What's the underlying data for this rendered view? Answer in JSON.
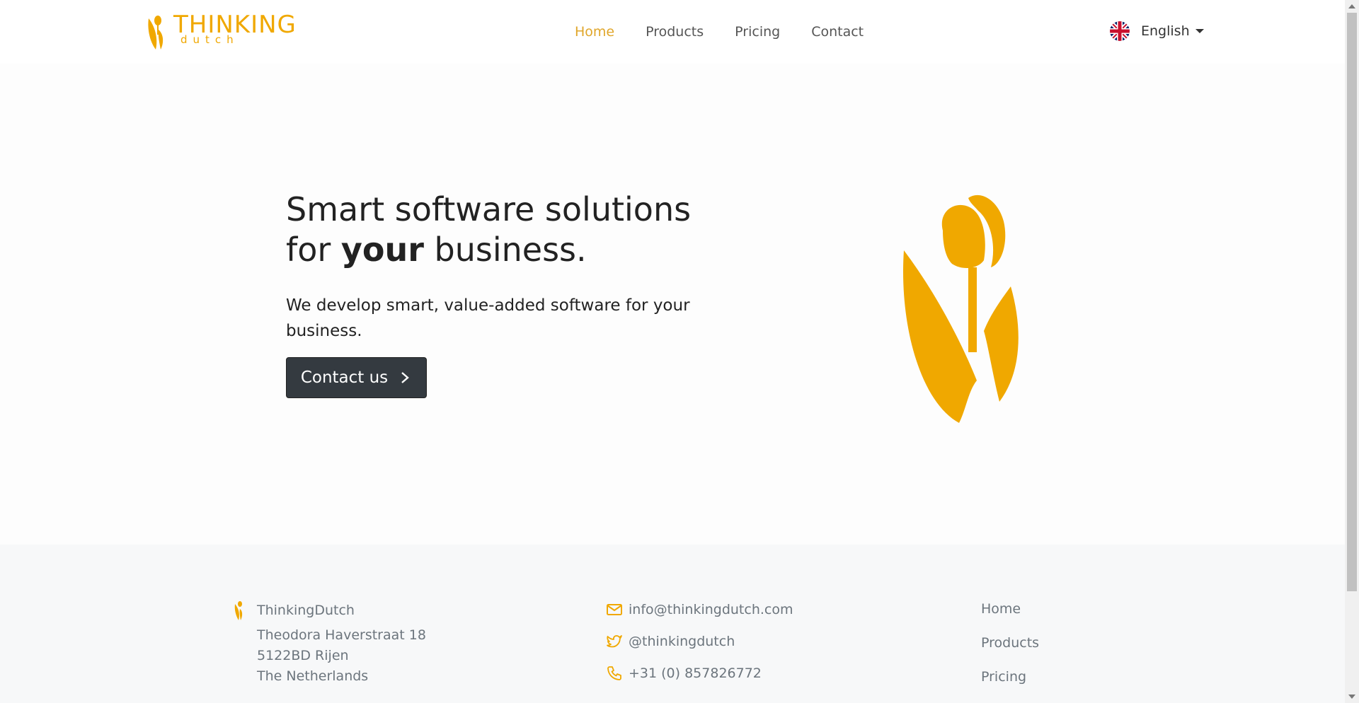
{
  "colors": {
    "accent": "#f0a800",
    "button_bg": "#343a40",
    "footer_bg": "#f7f8f9"
  },
  "brand": {
    "name_main": "THINKING",
    "name_sub": "dutch"
  },
  "nav": {
    "items": [
      {
        "label": "Home",
        "active": true
      },
      {
        "label": "Products",
        "active": false
      },
      {
        "label": "Pricing",
        "active": false
      },
      {
        "label": "Contact",
        "active": false
      }
    ],
    "language": {
      "label": "English",
      "icon": "uk-flag-icon"
    }
  },
  "hero": {
    "title_line1": "Smart software solutions",
    "title_for": "for ",
    "title_bold": "your",
    "title_end": " business.",
    "subtitle": "We develop smart, value-added software for your business.",
    "cta_label": "Contact us"
  },
  "footer": {
    "company": "ThinkingDutch",
    "address": [
      "Theodora Haverstraat 18",
      "5122BD Rijen",
      "The Netherlands"
    ],
    "email": "info@thinkingdutch.com",
    "twitter": "@thinkingdutch",
    "phone": "+31 (0) 857826772",
    "links": [
      "Home",
      "Products",
      "Pricing"
    ]
  }
}
